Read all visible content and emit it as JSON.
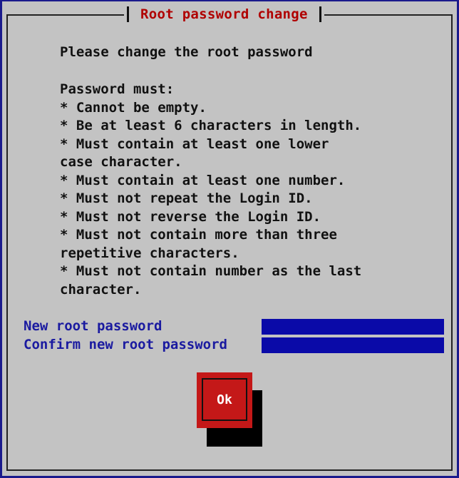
{
  "dialog": {
    "title": "Root password change",
    "intro": "Please change the root password",
    "rules_heading": "Password must:",
    "rules_lines": [
      "* Cannot be empty.",
      "* Be at least 6 characters in length.",
      "* Must contain at least one lower",
      "case character.",
      "* Must contain at least one number.",
      "* Must not repeat the Login ID.",
      "* Must not reverse the Login ID.",
      "* Must not contain more than three",
      "repetitive characters.",
      "* Must not contain number as the last",
      "character."
    ]
  },
  "form": {
    "new_password_label": "New root password",
    "new_password_value": "",
    "confirm_password_label": "Confirm new root password",
    "confirm_password_value": ""
  },
  "buttons": {
    "ok_label": "Ok"
  },
  "colors": {
    "background": "#c3c3c3",
    "title": "#b00000",
    "label": "#1a1aa0",
    "input_fill": "#0a0aa8",
    "button": "#c41818"
  }
}
